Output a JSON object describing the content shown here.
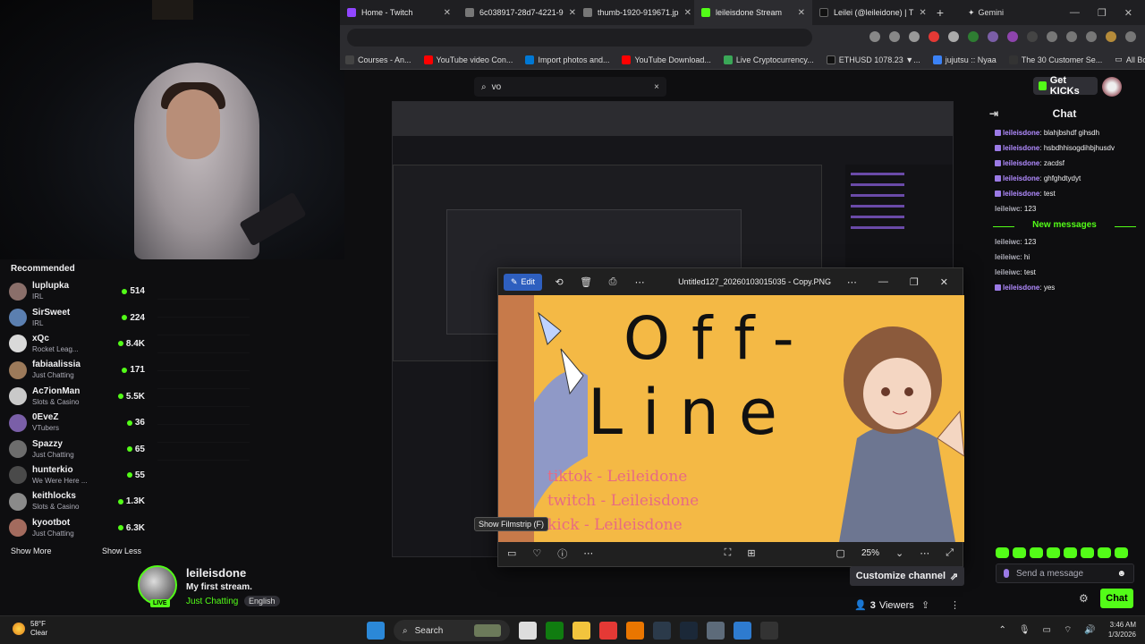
{
  "browser": {
    "tabs": [
      {
        "label": "Home - Twitch",
        "color": "#9146ff"
      },
      {
        "label": "6c038917-28d7-4221-9",
        "color": "#777777"
      },
      {
        "label": "thumb-1920-919671.jp",
        "color": "#777777"
      },
      {
        "label": "leileisdone Stream",
        "color": "#53fc18",
        "active": true
      },
      {
        "label": "Leilei (@leileidone) | T",
        "color": "#111111"
      }
    ],
    "gemini_label": "Gemini",
    "bookmarks": [
      {
        "label": "Courses - An...",
        "color": "#444444"
      },
      {
        "label": "YouTube video Con...",
        "color": "#ff0000"
      },
      {
        "label": "Import photos and...",
        "color": "#0078d4"
      },
      {
        "label": "YouTube Download...",
        "color": "#ff0000"
      },
      {
        "label": "Live Cryptocurrency...",
        "color": "#3aa757"
      },
      {
        "label": "ETHUSD 1078.23 ▼...",
        "color": "#111111"
      },
      {
        "label": "jujutsu :: Nyaa",
        "color": "#3b82f6"
      },
      {
        "label": "The 30 Customer Se...",
        "color": "#333333"
      }
    ],
    "all_bookmarks": "All Bookmarks"
  },
  "search": {
    "value": "vo",
    "clear": "×"
  },
  "header": {
    "get_kicks": "Get KICKs"
  },
  "sidebar": {
    "title": "Recommended",
    "items": [
      {
        "name": "luplupka",
        "category": "IRL",
        "viewers": "514",
        "color": "#8a6f6a"
      },
      {
        "name": "SirSweet",
        "category": "IRL",
        "viewers": "224",
        "color": "#5b7fb0"
      },
      {
        "name": "xQc",
        "category": "Rocket Leag...",
        "viewers": "8.4K",
        "color": "#d9d9d9"
      },
      {
        "name": "fabiaalissia",
        "category": "Just Chatting",
        "viewers": "171",
        "color": "#9c7a5a"
      },
      {
        "name": "Ac7ionMan",
        "category": "Slots & Casino",
        "viewers": "5.5K",
        "color": "#c9c9c9"
      },
      {
        "name": "0EveZ",
        "category": "VTubers",
        "viewers": "36",
        "color": "#7a5fa8"
      },
      {
        "name": "Spazzy",
        "category": "Just Chatting",
        "viewers": "65",
        "color": "#6d6d6d"
      },
      {
        "name": "hunterkio",
        "category": "We Were Here ...",
        "viewers": "55",
        "color": "#4a4a4a"
      },
      {
        "name": "keithlocks",
        "category": "Slots & Casino",
        "viewers": "1.3K",
        "color": "#8a8a8a"
      },
      {
        "name": "kyootbot",
        "category": "Just Chatting",
        "viewers": "6.3K",
        "color": "#a36b5e"
      }
    ],
    "show_more": "Show More",
    "show_less": "Show Less"
  },
  "channel": {
    "name": "leileisdone",
    "title": "My first stream.",
    "category": "Just Chatting",
    "language": "English",
    "live": "LIVE",
    "customize": "Customize channel",
    "viewers_count": "3",
    "viewers_label": "Viewers"
  },
  "viewer": {
    "edit": "Edit",
    "filename": "Untitled127_20260103015035 - Copy.PNG",
    "zoom": "25%",
    "tooltip": "Show Filmstrip (F)",
    "art_line1": "Off-",
    "art_line2": "Line",
    "social": [
      "tiktok - Leileidone",
      "twitch - Leileisdone",
      "kick - Leileisdone"
    ]
  },
  "chat": {
    "title": "Chat",
    "messages": [
      {
        "user": "leileisdone",
        "text": "blahjbshdf gihsdh",
        "badge": true
      },
      {
        "user": "leileisdone",
        "text": "hsbdhhisogdihbjhusdv",
        "badge": true
      },
      {
        "user": "leileisdone",
        "text": "zacdsf",
        "badge": true
      },
      {
        "user": "leileisdone",
        "text": "ghfghdtydyt",
        "badge": true
      },
      {
        "user": "leileisdone",
        "text": "test",
        "badge": true
      },
      {
        "user": "leileiwc",
        "text": "123",
        "badge": false
      }
    ],
    "new_messages": "New messages",
    "messages_after": [
      {
        "user": "leileiwc",
        "text": "123",
        "badge": false
      },
      {
        "user": "leileiwc",
        "text": "hi",
        "badge": false
      },
      {
        "user": "leileiwc",
        "text": "test",
        "badge": false
      },
      {
        "user": "leileisdone",
        "text": "yes",
        "badge": true
      }
    ],
    "send_placeholder": "Send a message",
    "chat_button": "Chat"
  },
  "taskbar": {
    "temp": "58°F",
    "weather": "Clear",
    "search": "Search",
    "time": "3:46 AM",
    "date": "1/3/2026"
  }
}
